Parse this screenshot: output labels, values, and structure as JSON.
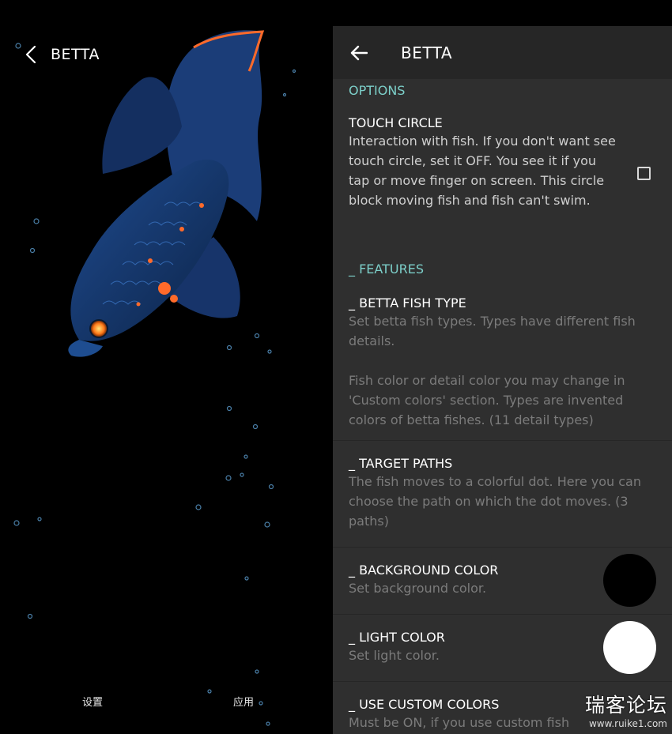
{
  "preview": {
    "title": "BETTA",
    "settings_label": "设置",
    "apply_label": "应用"
  },
  "appbar": {
    "title": "BETTA"
  },
  "options_header": "OPTIONS",
  "touch_circle": {
    "title": "TOUCH CIRCLE",
    "summary": "Interaction with fish. If you don't want see touch circle, set it OFF. You see it if you tap or move finger on screen. This circle block moving fish and fish can't swim.",
    "checked": false
  },
  "features_header": "_ FEATURES",
  "fish_type": {
    "title": "_ BETTA FISH TYPE",
    "summary": "Set betta fish types. Types have different fish details.",
    "summary2": "Fish color or detail color you may change in 'Custom colors' section. Types are invented colors of betta fishes. (11 detail types)"
  },
  "target_paths": {
    "title": "_ TARGET PATHS",
    "summary": "The fish moves to a colorful dot. Here you can choose the path on which the dot moves. (3 paths)"
  },
  "background_color": {
    "title": "_ BACKGROUND COLOR",
    "summary": "Set background color.",
    "value": "#000000"
  },
  "light_color": {
    "title": "_ LIGHT COLOR",
    "summary": "Set light color.",
    "value": "#ffffff"
  },
  "custom_colors": {
    "title": "_ USE CUSTOM COLORS",
    "summary": "Must be ON, if you use custom fish"
  },
  "watermark": {
    "main": "瑞客论坛",
    "url": "www.ruike1.com"
  },
  "colors": {
    "accent": "#7ccfc9",
    "panel": "#2f2f2f",
    "appbar": "#262626"
  }
}
